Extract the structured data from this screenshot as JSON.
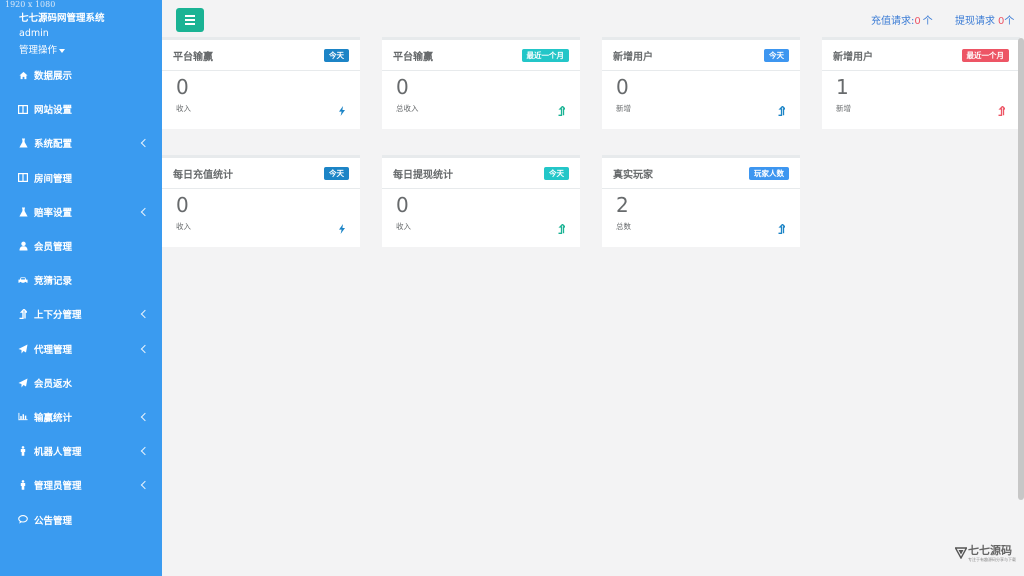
{
  "overlay": {
    "resolution_text": "1920 x 1080"
  },
  "sidebar": {
    "brand": "七七源码网管理系统",
    "username": "admin",
    "manage_label": "管理操作",
    "items": [
      {
        "label": "数据展示",
        "icon": "home-icon",
        "expandable": false
      },
      {
        "label": "网站设置",
        "icon": "columns-icon",
        "expandable": false
      },
      {
        "label": "系统配置",
        "icon": "flask-icon",
        "expandable": true
      },
      {
        "label": "房间管理",
        "icon": "columns-icon",
        "expandable": false
      },
      {
        "label": "赔率设置",
        "icon": "flask-icon",
        "expandable": true
      },
      {
        "label": "会员管理",
        "icon": "user-icon",
        "expandable": false
      },
      {
        "label": "竞猜记录",
        "icon": "car-icon",
        "expandable": false
      },
      {
        "label": "上下分管理",
        "icon": "level-up-icon",
        "expandable": true
      },
      {
        "label": "代理管理",
        "icon": "paper-plane-icon",
        "expandable": true
      },
      {
        "label": "会员返水",
        "icon": "paper-plane-icon",
        "expandable": false
      },
      {
        "label": "输赢统计",
        "icon": "bar-chart-icon",
        "expandable": true
      },
      {
        "label": "机器人管理",
        "icon": "male-icon",
        "expandable": true
      },
      {
        "label": "管理员管理",
        "icon": "male-icon",
        "expandable": true
      },
      {
        "label": "公告管理",
        "icon": "comment-icon",
        "expandable": false
      }
    ]
  },
  "topbar": {
    "recharge_label": "充值请求:",
    "recharge_count": "0",
    "recharge_unit": "个",
    "withdraw_label": "提现请求",
    "withdraw_count": "0",
    "withdraw_unit": "个"
  },
  "cards": [
    {
      "title": "平台输赢",
      "badge": "今天",
      "badge_color": "#1c84c6",
      "value": "0",
      "sub": "收入",
      "icon": "bolt-icon",
      "icon_color": "#1c84c6"
    },
    {
      "title": "平台输赢",
      "badge": "最近一个月",
      "badge_color": "#23c6c8",
      "value": "0",
      "sub": "总收入",
      "icon": "level-up-icon",
      "icon_color": "#1ab394"
    },
    {
      "title": "新增用户",
      "badge": "今天",
      "badge_color": "#3d96f0",
      "value": "0",
      "sub": "新增",
      "icon": "level-up-icon",
      "icon_color": "#1c84c6"
    },
    {
      "title": "新增用户",
      "badge": "最近一个月",
      "badge_color": "#ed5565",
      "value": "1",
      "sub": "新增",
      "icon": "level-up-icon",
      "icon_color": "#ed5565"
    },
    {
      "title": "每日充值统计",
      "badge": "今天",
      "badge_color": "#1c84c6",
      "value": "0",
      "sub": "收入",
      "icon": "bolt-icon",
      "icon_color": "#1c84c6"
    },
    {
      "title": "每日提现统计",
      "badge": "今天",
      "badge_color": "#23c6c8",
      "value": "0",
      "sub": "收入",
      "icon": "level-up-icon",
      "icon_color": "#1ab394"
    },
    {
      "title": "真实玩家",
      "badge": "玩家人数",
      "badge_color": "#3d96f0",
      "value": "2",
      "sub": "总数",
      "icon": "level-up-icon",
      "icon_color": "#1c84c6"
    }
  ],
  "watermark": {
    "title": "七七源码",
    "subtitle": "专注于有趣源码分享与下载"
  }
}
